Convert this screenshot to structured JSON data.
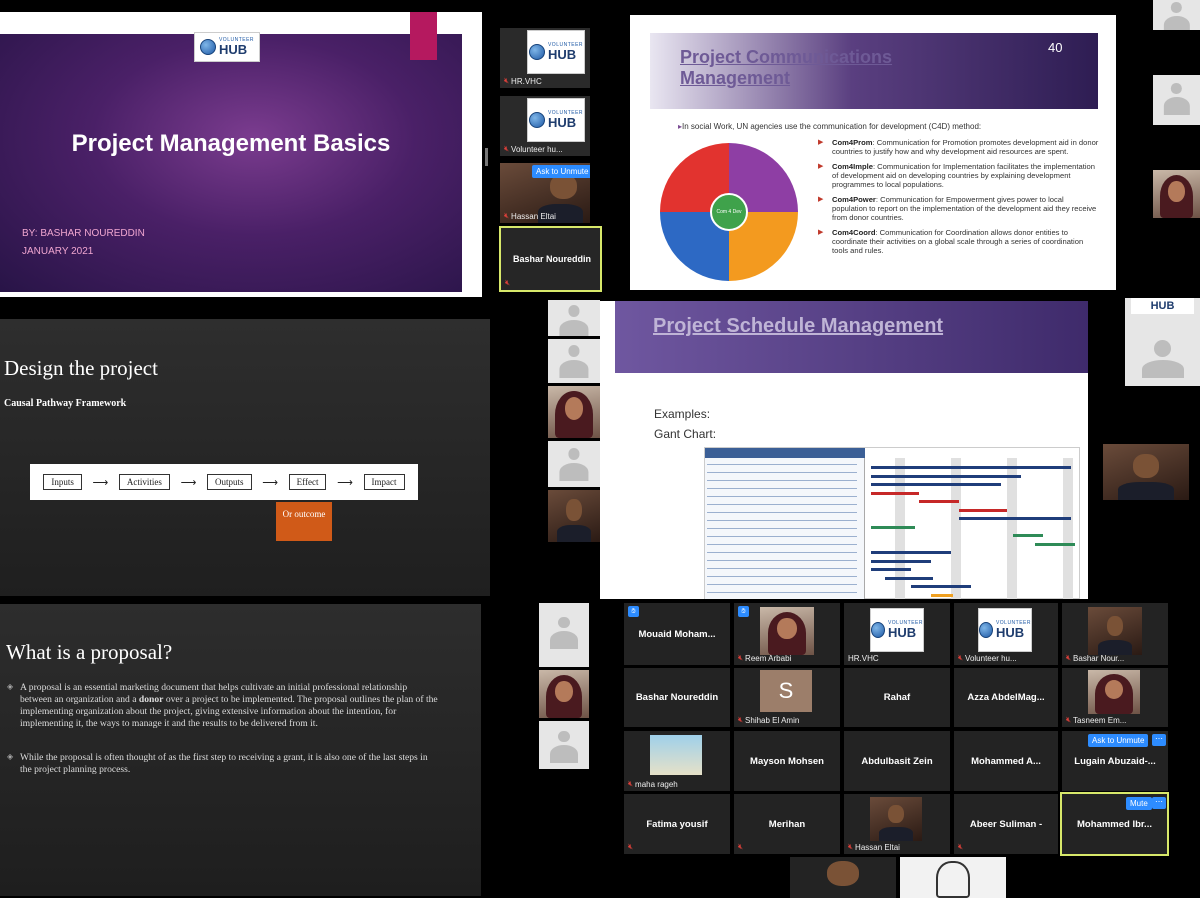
{
  "title_slide": {
    "logo": {
      "small": "VOLUNTEER",
      "big": "HUB"
    },
    "title": "Project Management Basics",
    "author": "BY: BASHAR NOUREDDIN",
    "date": "JANUARY 2021"
  },
  "strip_top": {
    "tiles": [
      {
        "name": "HR.VHC"
      },
      {
        "name": "Volunteer hu..."
      },
      {
        "name": "Hassan Eltai",
        "badge": "Ask to Unmute"
      },
      {
        "name": "Bashar Noureddin"
      }
    ]
  },
  "comms_slide": {
    "title": "Project Communications Management",
    "page_number": "40",
    "intro": "In social Work, UN agencies use the communication for development (C4D) method:",
    "center_label": "Com 4 Dev",
    "items": [
      {
        "term": "Com4Prom",
        "text": ": Communication for Promotion promotes development aid in donor countries to justify how and why development aid resources are spent."
      },
      {
        "term": "Com4Imple",
        "text": ": Communication for Implementation facilitates the implementation of development aid on developing countries by explaining development programmes to local populations."
      },
      {
        "term": "Com4Power",
        "text": ": Communication for Empowerment gives power to local population to report on the implementation of the development aid they receive from donor countries."
      },
      {
        "term": "Com4Coord",
        "text": ": Communication for Coordination allows donor entities to coordinate their activities on a global scale through a series of coordination tools and rules."
      }
    ]
  },
  "design_slide": {
    "title": "Design the project",
    "subtitle": "Causal Pathway Framework",
    "steps": [
      "Inputs",
      "Activities",
      "Outputs",
      "Effect",
      "Impact"
    ],
    "arrow": "⟶",
    "or_box": "Or outcome"
  },
  "schedule_slide": {
    "title": "Project Schedule Management",
    "line1": "Examples:",
    "line2": "Gant Chart:"
  },
  "proposal_slide": {
    "title": "What is a proposal?",
    "para1_a": "A proposal is an essential marketing document that helps cultivate an initial professional relationship between an organization and a ",
    "para1_bold": "donor",
    "para1_b": " over a project to be implemented. The proposal outlines the plan of the implementing organization about the project, giving extensive information about the intention, for implementing it, the ways to manage it and the results to be delivered from it.",
    "para2": "While the proposal is often thought of as the first step to receiving a grant, it is also one of the last steps in the project planning process."
  },
  "gallery": {
    "mute_badge": "Mute",
    "ask_badge": "Ask to Unmute",
    "more": "⋯",
    "s_initial": "S",
    "r1": [
      "Mouaid Moham...",
      "Reem Arbabi",
      "HR.VHC",
      "Volunteer hu...",
      "Bashar Nour..."
    ],
    "r2": [
      "Bashar Noureddin",
      "Shihab El Amin",
      "Rahaf",
      "Azza AbdelMag...",
      "Tasneem Em..."
    ],
    "r3": [
      "maha rageh",
      "Mayson Mohsen",
      "Abdulbasit Zein",
      "Mohammed A...",
      "Lugain Abuzaid-..."
    ],
    "r4": [
      "Fatima yousif",
      "Merihan",
      "Hassan Eltai",
      "Abeer Suliman -",
      "Mohammed Ibr..."
    ]
  },
  "colors": {
    "accent": "#2d8cff",
    "slide_purple": "#4a2067",
    "active_border": "#d7e86a"
  }
}
